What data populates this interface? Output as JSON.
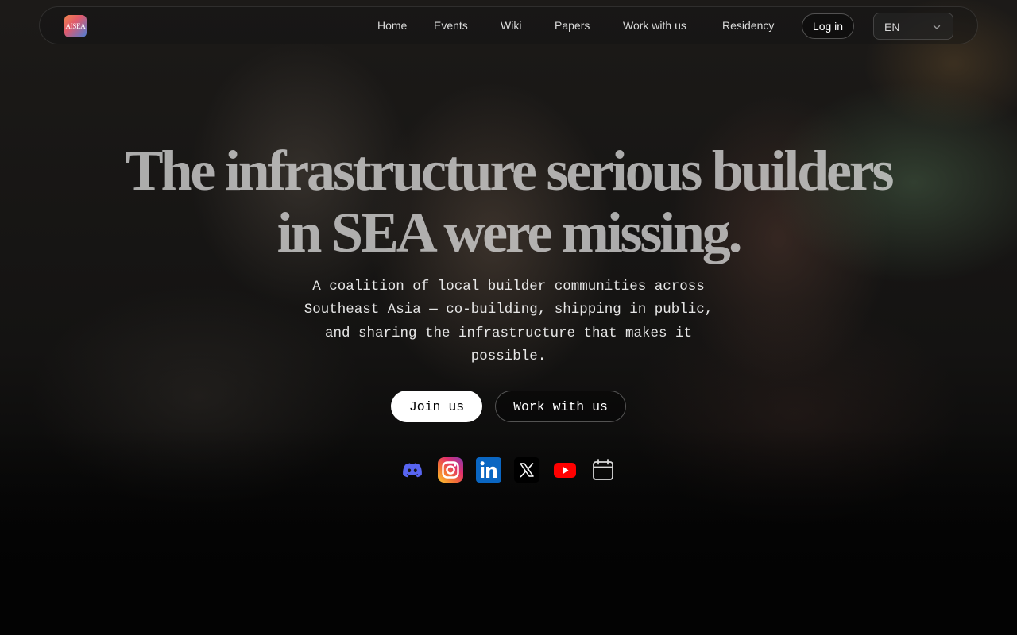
{
  "nav": {
    "logo_text": "AISEA",
    "links": [
      {
        "label": "Home"
      },
      {
        "label": "Events"
      },
      {
        "label": "Wiki"
      },
      {
        "label": "Papers"
      },
      {
        "label": "Work with us"
      },
      {
        "label": "Residency"
      }
    ],
    "login_label": "Log in",
    "language": {
      "selected": "EN"
    }
  },
  "hero": {
    "title": "The infrastructure serious builders in SEA were missing.",
    "subtitle": "A coalition of local builder communities across Southeast Asia — co-building, shipping in public, and sharing the infrastructure that makes it possible.",
    "primary_cta": "Join us",
    "secondary_cta": "Work with us"
  },
  "socials": [
    {
      "name": "discord-icon",
      "color": "#5865F2"
    },
    {
      "name": "instagram-icon",
      "color": "#E1306C"
    },
    {
      "name": "linkedin-icon",
      "color": "#0A66C2"
    },
    {
      "name": "x-icon",
      "color": "#000000"
    },
    {
      "name": "youtube-icon",
      "color": "#FF0000"
    },
    {
      "name": "calendar-icon",
      "color": "#D9D9D9"
    }
  ],
  "colors": {
    "primary_button_bg": "#FFFFFF",
    "page_bg": "#0B0B0B"
  }
}
